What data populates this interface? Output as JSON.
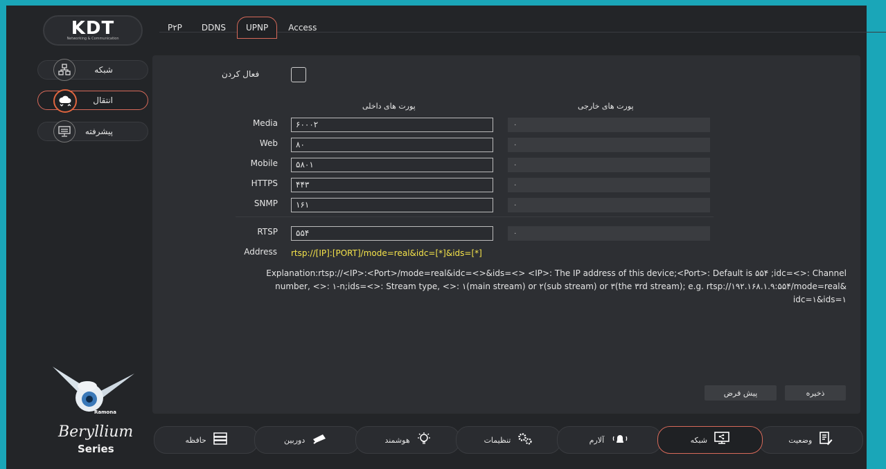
{
  "logo": {
    "mark": "KDT",
    "sub": "Networking & Communication"
  },
  "tabs": [
    {
      "label": "P۲P"
    },
    {
      "label": "DDNS"
    },
    {
      "label": "UPNP",
      "active": true
    },
    {
      "label": "Access"
    }
  ],
  "sidebar": [
    {
      "label": "شبکه",
      "icon": "network-icon"
    },
    {
      "label": "انتقال",
      "icon": "cloud-sync-icon",
      "active": true
    },
    {
      "label": "پیشرفته",
      "icon": "monitor-icon"
    }
  ],
  "form": {
    "enable_label": "فعال کردن",
    "enabled": false,
    "internal_header": "پورت های داخلی",
    "external_header": "پورت های خارجی",
    "rows": [
      {
        "label": "Media",
        "internal": "۶۰۰۰۲",
        "external": "۰"
      },
      {
        "label": "Web",
        "internal": "۸۰",
        "external": "۰"
      },
      {
        "label": "Mobile",
        "internal": "۵۸۰۱",
        "external": "۰"
      },
      {
        "label": "HTTPS",
        "internal": "۴۴۳",
        "external": "۰"
      },
      {
        "label": "SNMP",
        "internal": "۱۶۱",
        "external": "۰"
      },
      {
        "label": "RTSP",
        "internal": "۵۵۴",
        "external": "۰"
      }
    ],
    "address_label": "Address",
    "address_value": "rtsp://[IP]:[PORT]/mode=real&idc=[*]&ids=[*]",
    "explanation": "Explanation:rtsp://<IP>:<Port>/mode=real&idc=<>&ids=<> <IP>: The IP address of this device;<Port>: Default is ۵۵۴ ;idc=<>: Channel number, <>: ۱-n;ids=<>: Stream type, <>: ۱(main stream) or ۲(sub stream) or ۳(the ۳rd stream); e.g. rtsp://۱۹۲.۱۶۸.۱.۹:۵۵۴/mode=real& idc=۱&ids=۱"
  },
  "buttons": {
    "default": "پیش فرض",
    "save": "ذخیره"
  },
  "brand": {
    "name": "Beryllium",
    "series": "Series",
    "mascot": "Ramona"
  },
  "bottom_nav": [
    {
      "label": "حافظه",
      "icon": "storage-icon"
    },
    {
      "label": "دوربین",
      "icon": "camera-icon"
    },
    {
      "label": "هوشمند",
      "icon": "bulb-icon"
    },
    {
      "label": "تنظیمات",
      "icon": "gears-icon"
    },
    {
      "label": "آلارم",
      "icon": "alarm-icon"
    },
    {
      "label": "شبکه",
      "icon": "network-monitor-icon",
      "active": true
    },
    {
      "label": "وضعیت",
      "icon": "status-icon"
    }
  ]
}
